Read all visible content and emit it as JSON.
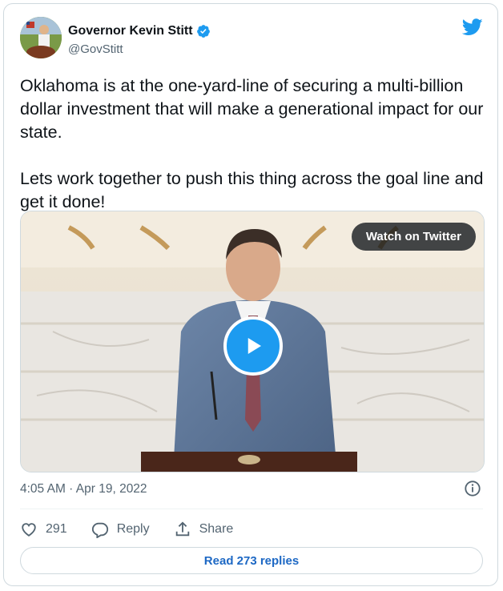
{
  "author": {
    "name": "Governor Kevin Stitt",
    "handle": "@GovStitt",
    "verified": true
  },
  "tweet": {
    "paragraphs": [
      "Oklahoma is at the one-yard-line of securing a multi-billion dollar investment that will make a generational impact for our state.",
      "Lets work together to push this thing across the goal line and get it done!"
    ],
    "timestamp": "4:05 AM · Apr 19, 2022"
  },
  "media": {
    "watch_label": "Watch on Twitter"
  },
  "actions": {
    "like_count": "291",
    "reply_label": "Reply",
    "share_label": "Share"
  },
  "footer": {
    "read_replies_label": "Read 273 replies"
  },
  "colors": {
    "accent": "#1d9bf0",
    "text": "#0f1419",
    "muted": "#536471",
    "link": "#1d68c4"
  }
}
